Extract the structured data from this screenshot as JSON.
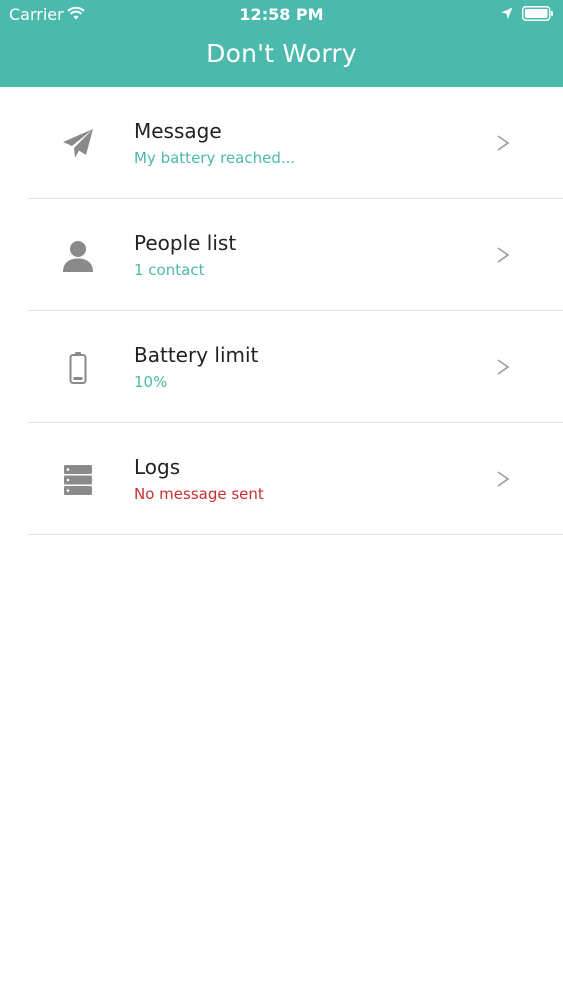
{
  "status_bar": {
    "carrier": "Carrier",
    "time": "12:58 PM"
  },
  "header": {
    "title": "Don't Worry",
    "background_color": "#4cb9ad"
  },
  "menu": {
    "items": [
      {
        "label": "Message",
        "detail": "My battery reached...",
        "icon": "paper-plane-icon",
        "detail_color": "#4cb9ad"
      },
      {
        "label": "People list",
        "detail": "1 contact",
        "icon": "person-icon",
        "detail_color": "#4cb9ad"
      },
      {
        "label": "Battery limit",
        "detail": "10%",
        "icon": "battery-icon",
        "detail_color": "#4cb9ad"
      },
      {
        "label": "Logs",
        "detail": "No message sent",
        "icon": "server-icon",
        "detail_color": "#c8312f"
      }
    ]
  }
}
